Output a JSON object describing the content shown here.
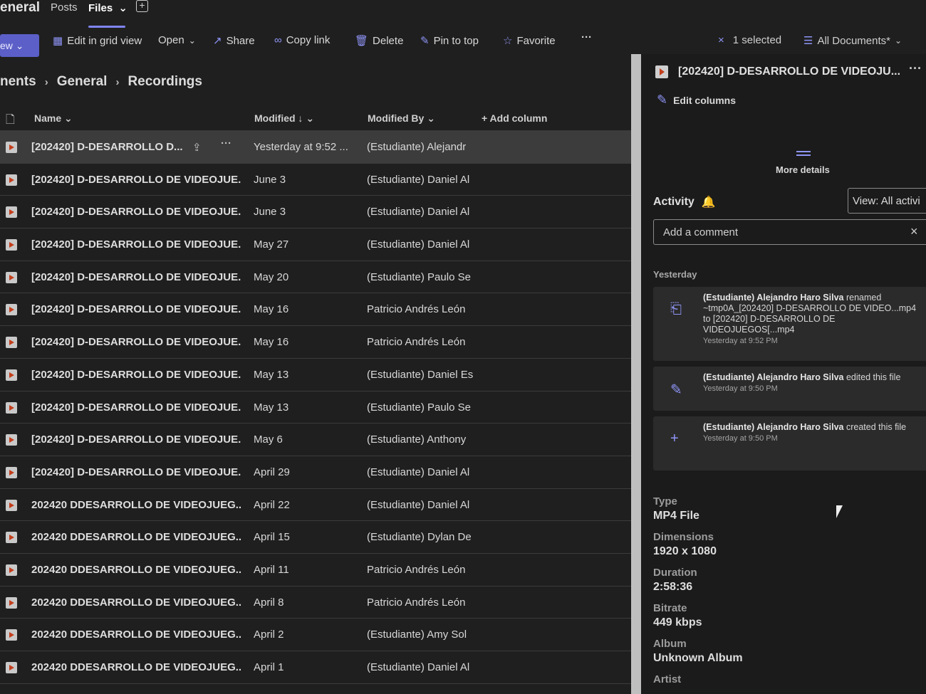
{
  "topnav": {
    "crumb": "eneral",
    "posts": "Posts",
    "files": "Files",
    "files_chevron": "⌄",
    "add_tab": "+"
  },
  "cmdbar": {
    "new_label": "ew ⌄",
    "edit_grid": "Edit in grid view",
    "open": "Open",
    "share": "Share",
    "copy_link": "Copy link",
    "delete": "Delete",
    "pin": "Pin to top",
    "favorite": "Favorite",
    "more": "···",
    "clear": "×",
    "selected": "1 selected",
    "view": "All Documents*"
  },
  "breadcrumb": {
    "a": "nents",
    "b": "General",
    "c": "Recordings",
    "sep": "›"
  },
  "columns": {
    "name": "Name",
    "modified": "Modified ↓",
    "modified_by": "Modified By",
    "add_column": "Add column"
  },
  "rows": [
    {
      "name": "[202420] D-DESARROLLO D...",
      "modified": "Yesterday at 9:52 ...",
      "by": "(Estudiante) Alejandr"
    },
    {
      "name": "[202420] D-DESARROLLO DE VIDEOJUE...",
      "modified": "June 3",
      "by": "(Estudiante) Daniel Al"
    },
    {
      "name": "[202420] D-DESARROLLO DE VIDEOJUE...",
      "modified": "June 3",
      "by": "(Estudiante) Daniel Al"
    },
    {
      "name": "[202420] D-DESARROLLO DE VIDEOJUE...",
      "modified": "May 27",
      "by": "(Estudiante) Daniel Al"
    },
    {
      "name": "[202420] D-DESARROLLO DE VIDEOJUE...",
      "modified": "May 20",
      "by": "(Estudiante) Paulo Se"
    },
    {
      "name": "[202420] D-DESARROLLO DE VIDEOJUE...",
      "modified": "May 16",
      "by": "Patricio Andrés León"
    },
    {
      "name": "[202420] D-DESARROLLO DE VIDEOJUE...",
      "modified": "May 16",
      "by": "Patricio Andrés León"
    },
    {
      "name": "[202420] D-DESARROLLO DE VIDEOJUE...",
      "modified": "May 13",
      "by": "(Estudiante) Daniel Es"
    },
    {
      "name": "[202420] D-DESARROLLO DE VIDEOJUE...",
      "modified": "May 13",
      "by": "(Estudiante) Paulo Se"
    },
    {
      "name": "[202420] D-DESARROLLO DE VIDEOJUE...",
      "modified": "May 6",
      "by": "(Estudiante) Anthony"
    },
    {
      "name": "[202420] D-DESARROLLO DE VIDEOJUE...",
      "modified": "April 29",
      "by": "(Estudiante) Daniel Al"
    },
    {
      "name": "202420 DDESARROLLO DE VIDEOJUEG...",
      "modified": "April 22",
      "by": "(Estudiante) Daniel Al"
    },
    {
      "name": "202420 DDESARROLLO DE VIDEOJUEG...",
      "modified": "April 15",
      "by": "(Estudiante) Dylan De"
    },
    {
      "name": "202420 DDESARROLLO DE VIDEOJUEG...",
      "modified": "April 11",
      "by": "Patricio Andrés León"
    },
    {
      "name": "202420 DDESARROLLO DE VIDEOJUEG...",
      "modified": "April 8",
      "by": "Patricio Andrés León"
    },
    {
      "name": "202420 DDESARROLLO DE VIDEOJUEG...",
      "modified": "April 2",
      "by": "(Estudiante) Amy Sol"
    },
    {
      "name": "202420 DDESARROLLO DE VIDEOJUEG...",
      "modified": "April 1",
      "by": "(Estudiante) Daniel Al"
    }
  ],
  "panel": {
    "title": "[202420] D-DESARROLLO DE VIDEOJU...",
    "more": "···",
    "edit_columns": "Edit columns",
    "more_details": "More details",
    "activity": "Activity",
    "view_filter": "View: All activi",
    "add_comment": "Add a comment",
    "close": "×",
    "yesterday": "Yesterday",
    "activities": [
      {
        "who": "(Estudiante) Alejandro Haro Silva",
        "what": " renamed ~tmp0A_[202420] D-DESARROLLO DE VIDEO...mp4 to [202420] D-DESARROLLO DE VIDEOJUEGOS[...mp4",
        "when": "Yesterday at 9:52 PM"
      },
      {
        "who": "(Estudiante) Alejandro Haro Silva",
        "what": " edited this file",
        "when": "Yesterday at 9:50 PM"
      },
      {
        "who": "(Estudiante) Alejandro Haro Silva",
        "what": " created this file",
        "when": "Yesterday at 9:50 PM"
      }
    ],
    "props": [
      {
        "key": "Type",
        "value": "MP4 File"
      },
      {
        "key": "Dimensions",
        "value": "1920 x 1080"
      },
      {
        "key": "Duration",
        "value": "2:58:36"
      },
      {
        "key": "Bitrate",
        "value": "449 kbps"
      },
      {
        "key": "Album",
        "value": "Unknown Album"
      },
      {
        "key": "Artist",
        "value": ""
      }
    ]
  },
  "colors": {
    "accent": "#7f85f5",
    "brand": "#5b5fc7",
    "video_icon": "#c43e1c"
  }
}
